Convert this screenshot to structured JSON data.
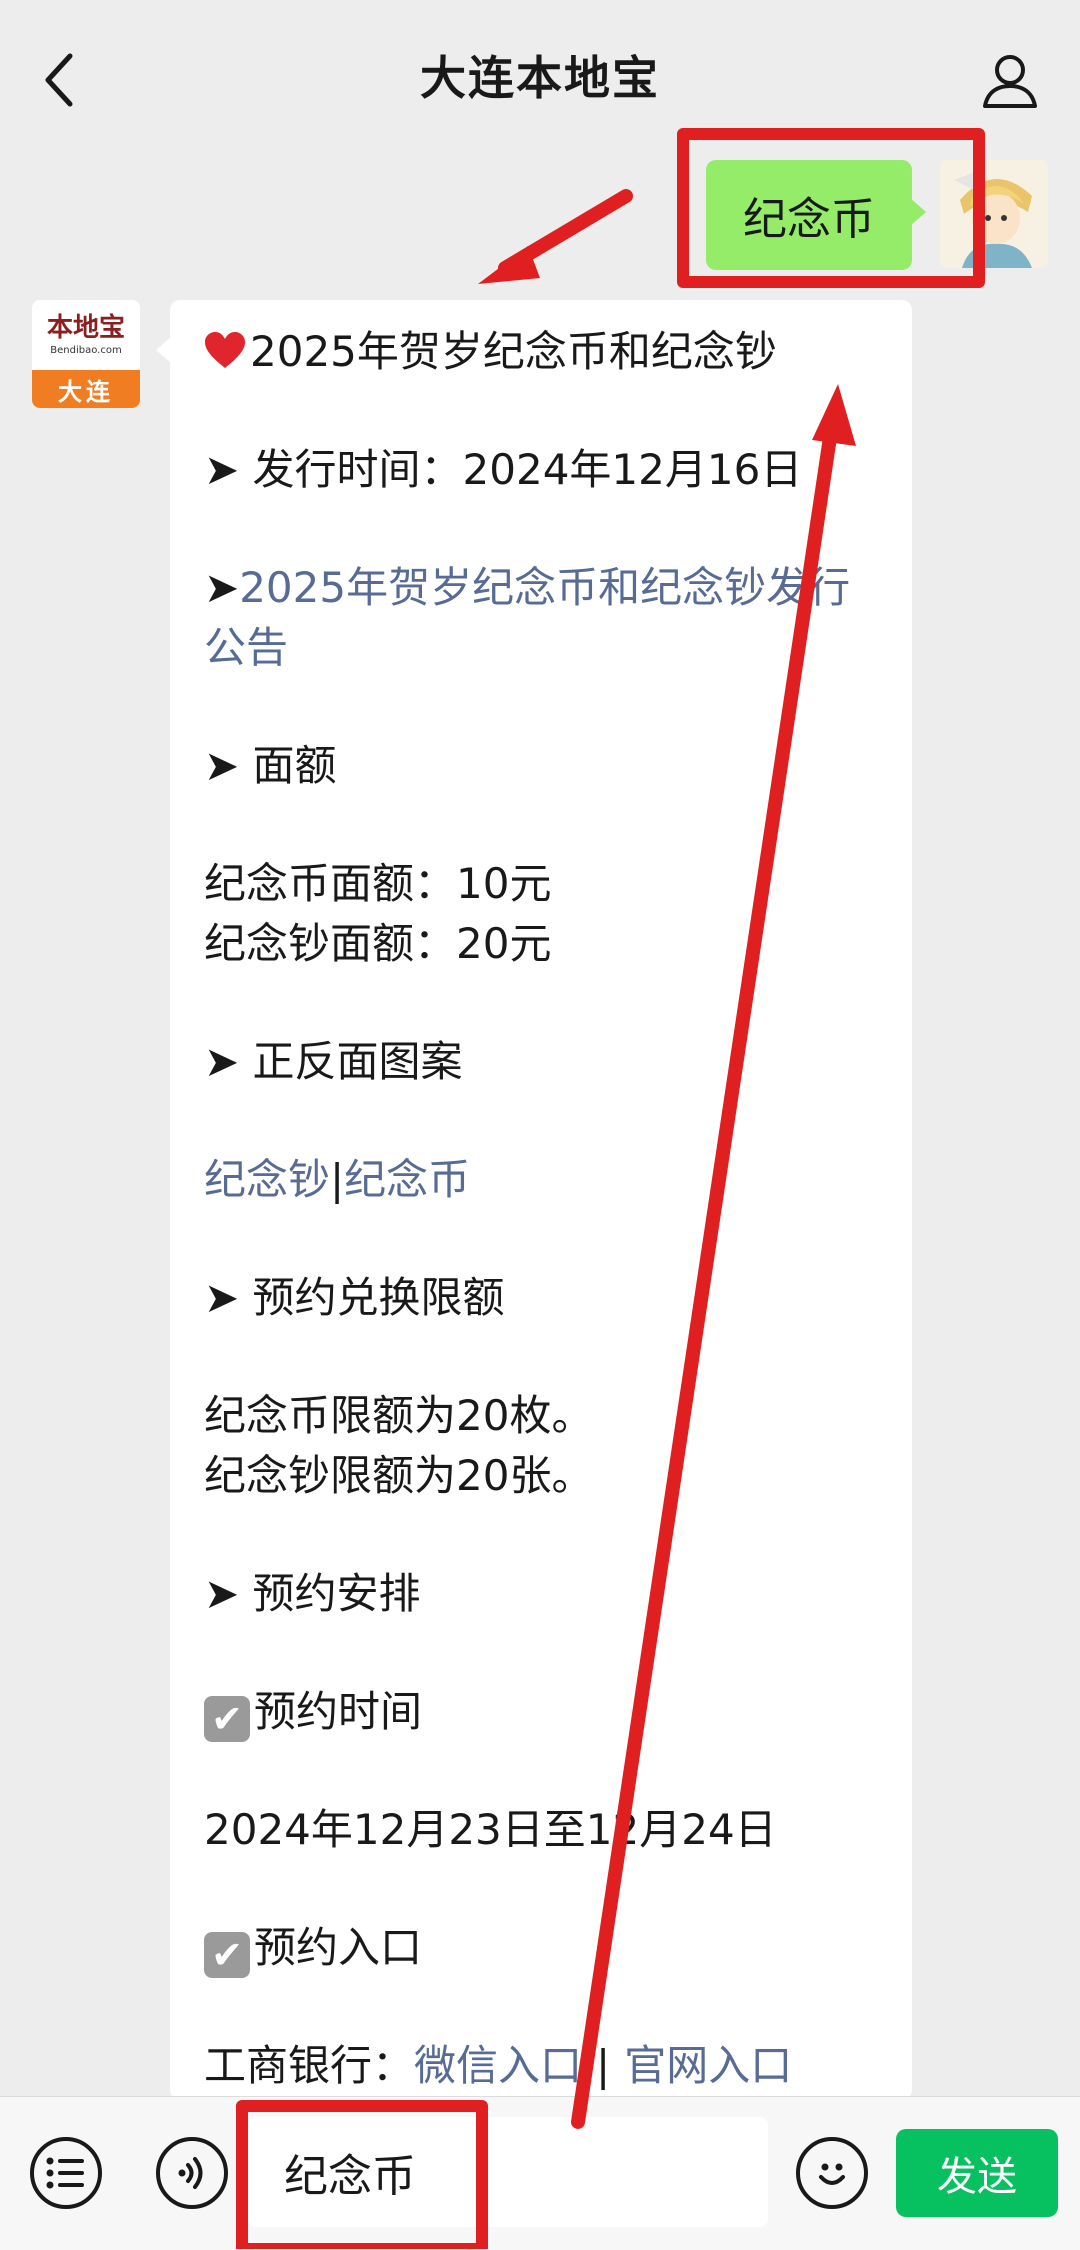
{
  "header": {
    "title": "大连本地宝"
  },
  "sent_message": {
    "text": "纪念币"
  },
  "official_avatar": {
    "brand": "本地宝",
    "domain": "Bendibao.com",
    "city": "大连"
  },
  "reply": {
    "title": "2025年贺岁纪念币和纪念钞",
    "issue_time": "➤ 发行时间：2024年12月16日",
    "notice_arrow": "➤",
    "notice_link": "2025年贺岁纪念币和纪念钞发行公告",
    "denomination_heading": "➤ 面额",
    "coin_denomination": "纪念币面额：10元",
    "note_denomination": "纪念钞面额：20元",
    "pattern_heading": "➤ 正反面图案",
    "pattern_link_note": "纪念钞",
    "pattern_separator": "|",
    "pattern_link_coin": "纪念币",
    "limit_heading": "➤ 预约兑换限额",
    "coin_limit": "纪念币限额为20枚。",
    "note_limit": "纪念钞限额为20张。",
    "schedule_heading": "➤ 预约安排",
    "reserve_time_label": "预约时间",
    "reserve_time_value": "2024年12月23日至12月24日",
    "reserve_entry_label": "预约入口",
    "bank_label": "工商银行：",
    "wechat_entry": "微信入口",
    "entry_separator": "|",
    "website_entry": "官网入口"
  },
  "input_bar": {
    "input_value": "纪念币",
    "send_label": "发送"
  },
  "icons": [
    "back-icon",
    "user-icon",
    "heart-icon",
    "check-icon",
    "menu-icon",
    "voice-icon",
    "emoji-icon"
  ],
  "colors": {
    "sent_bubble": "#95ec69",
    "link": "#576b95",
    "send_button": "#07c160",
    "annotation": "#e02020"
  }
}
